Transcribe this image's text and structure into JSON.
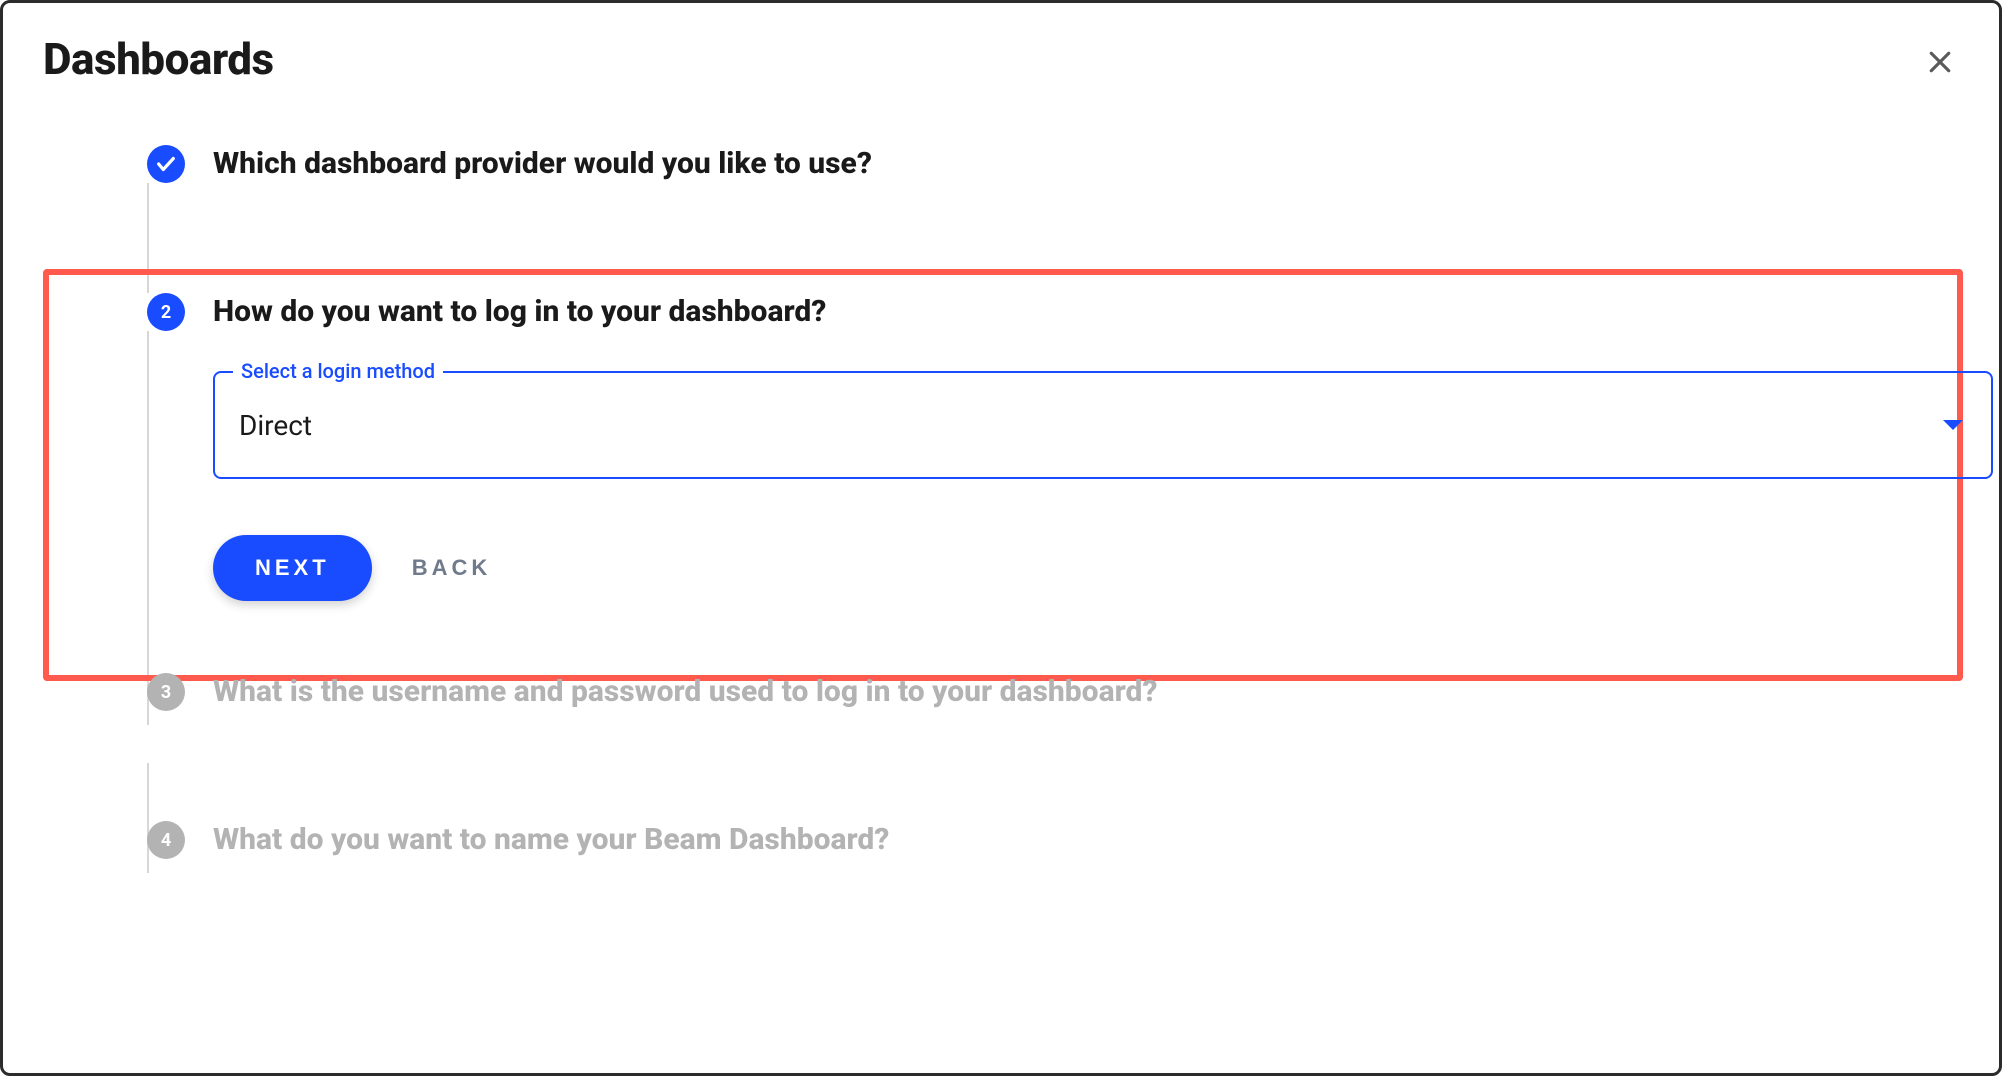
{
  "dialog": {
    "title": "Dashboards"
  },
  "steps": {
    "s1": {
      "label": "Which dashboard provider would you like to use?"
    },
    "s2": {
      "number": "2",
      "label": "How do you want to log in to your dashboard?",
      "select": {
        "float_label": "Select a login method",
        "value": "Direct"
      },
      "next_label": "NEXT",
      "back_label": "BACK"
    },
    "s3": {
      "number": "3",
      "label": "What is the username and password used to log in to your dashboard?"
    },
    "s4": {
      "number": "4",
      "label": "What do you want to name your Beam Dashboard?"
    }
  }
}
